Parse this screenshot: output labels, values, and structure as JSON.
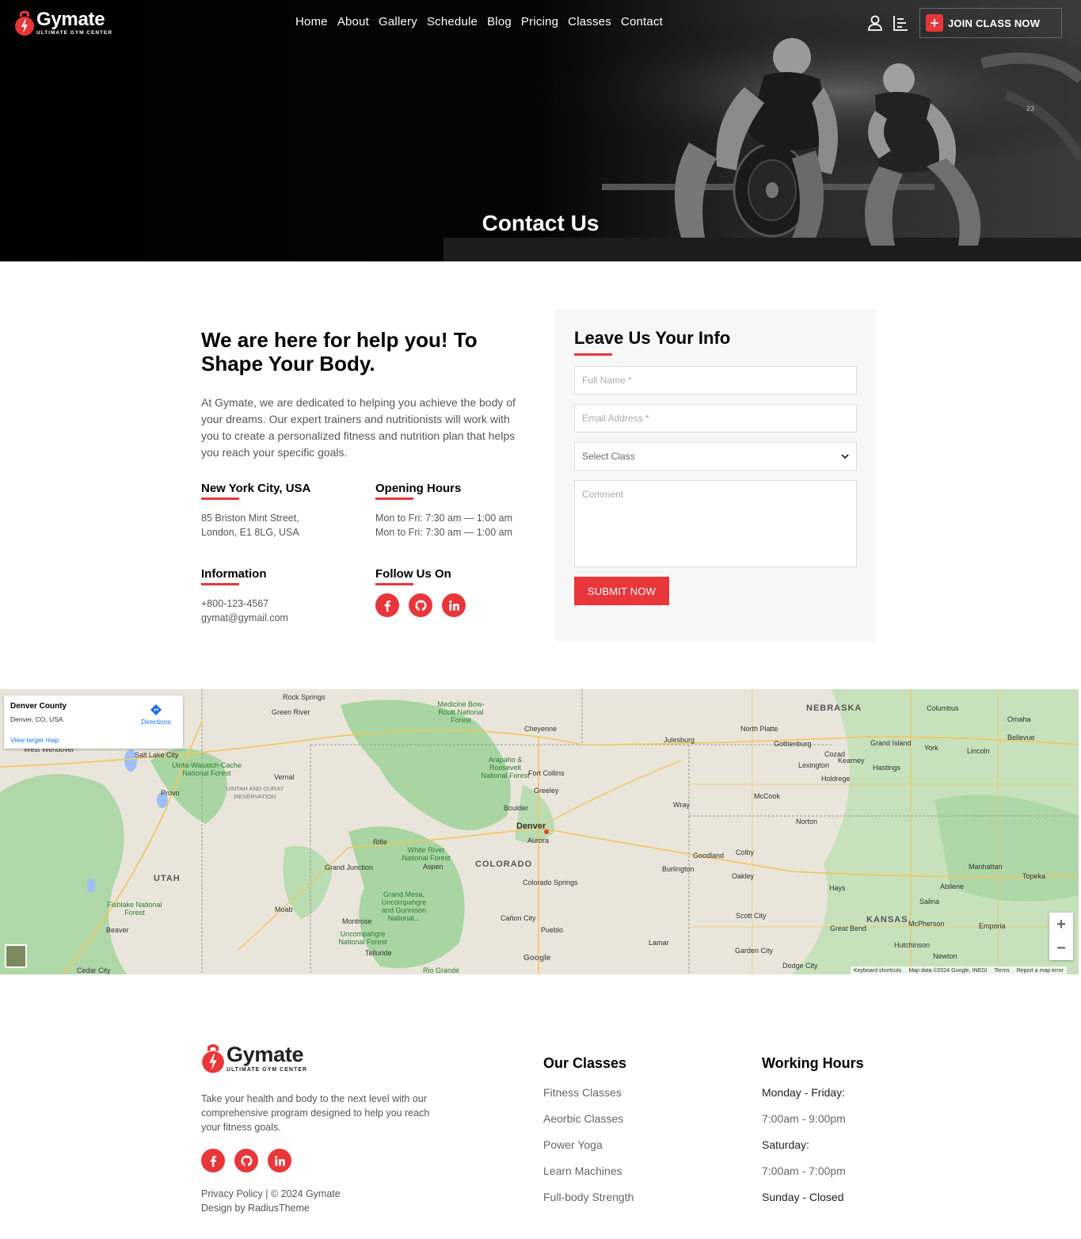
{
  "brand": {
    "name": "Gymate",
    "tagline": "ULTIMATE GYM CENTER",
    "accent": "#e8363a"
  },
  "nav": {
    "items": [
      "Home",
      "About",
      "Gallery",
      "Schedule",
      "Blog",
      "Pricing",
      "Classes",
      "Contact"
    ],
    "user_icon": "user-icon",
    "menu_icon": "menu-bars-icon",
    "join_label": "JOIN CLASS NOW"
  },
  "hero": {
    "title": "Contact Us",
    "overlay_text": "23"
  },
  "contact": {
    "heading": "We are here for help you! To Shape Your Body.",
    "description": "At Gymate, we are dedicated to helping you achieve the body of your dreams. Our expert trainers and nutritionists will work with you to create a personalized fitness and nutrition plan that helps you reach your specific goals.",
    "location": {
      "title": "New York City, USA",
      "line1": "85 Briston Mint Street,",
      "line2": "London, E1 8LG, USA"
    },
    "hours": {
      "title": "Opening Hours",
      "line1": "Mon to Fri: 7:30 am — 1:00 am",
      "line2": "Mon to Fri: 7:30 am — 1:00 am"
    },
    "information": {
      "title": "Information",
      "phone": "+800-123-4567",
      "email": "gymat@gymail.com"
    },
    "follow": {
      "title": "Follow Us On",
      "icons": [
        "facebook-icon",
        "github-icon",
        "linkedin-icon"
      ]
    }
  },
  "form": {
    "title": "Leave Us Your Info",
    "name_placeholder": "Full Name *",
    "email_placeholder": "Email Address *",
    "select_value": "Select Class",
    "comment_placeholder": "Comment",
    "submit_label": "SUBMIT NOW"
  },
  "map": {
    "place_title": "Denver County",
    "place_sub": "Denver, CO, USA",
    "directions_label": "Directions",
    "larger_map_label": "View larger map",
    "zoom_in": "+",
    "zoom_out": "−",
    "attribution": [
      "Keyboard shortcuts",
      "Map data ©2024 Google, INEGI",
      "Terms",
      "Report a map error"
    ],
    "google_label": "Google",
    "states": [
      "NEBRASKA",
      "UTAH",
      "COLORADO",
      "KANSAS"
    ],
    "cities": [
      "Rock Springs",
      "Green River",
      "Cheyenne",
      "Julesburg",
      "North Platte",
      "Gothenburg",
      "Cozad",
      "Lexington",
      "Kearney",
      "Grand Island",
      "Hastings",
      "York",
      "Lincoln",
      "Omaha",
      "Bellevue",
      "Columbus",
      "Salt Lake City",
      "West Wendover",
      "Provo",
      "Vernal",
      "Fort Collins",
      "Greeley",
      "Boulder",
      "Denver",
      "Aurora",
      "Wray",
      "McCook",
      "Holdrege",
      "Norton",
      "Rifle",
      "Aspen",
      "Grand Junction",
      "Colorado Springs",
      "Pueblo",
      "Cañon City",
      "Montrose",
      "Moab",
      "Telluride",
      "Goodland",
      "Colby",
      "Burlington",
      "Oakley",
      "Hays",
      "Salina",
      "Abilene",
      "Manhattan",
      "Topeka",
      "Scott City",
      "Great Bend",
      "McPherson",
      "Emporia",
      "Hutchinson",
      "Newton",
      "Garden City",
      "Dodge City",
      "Lamar",
      "Beaver",
      "Cedar City"
    ],
    "parks": [
      "Medicine Bow-Routt National Forest",
      "Uinta-Wasatch-Cache National Forest",
      "UINTAH AND OURAY RESERVATION",
      "Arapaho & Roosevelt National Forest",
      "White River National Forest",
      "Grand Mesa, Uncompahgre and Gunnison National...",
      "Uncompahgre National Forest",
      "Fishlake National Forest",
      "Rio Grande"
    ]
  },
  "footer": {
    "description": "Take your health and body to the next level with our comprehensive program designed to help you reach your fitness goals.",
    "legal_line1": "Privacy Policy | © 2024 Gymate",
    "legal_line2": "Design by RadiusTheme",
    "classes_title": "Our Classes",
    "classes": [
      "Fitness Classes",
      "Aeorbic Classes",
      "Power Yoga",
      "Learn Machines",
      "Full-body Strength"
    ],
    "hours_title": "Working Hours",
    "hours": [
      "Monday - Friday:",
      "7:00am - 9:00pm",
      "Saturday:",
      "7:00am - 7:00pm",
      "Sunday - Closed"
    ]
  }
}
